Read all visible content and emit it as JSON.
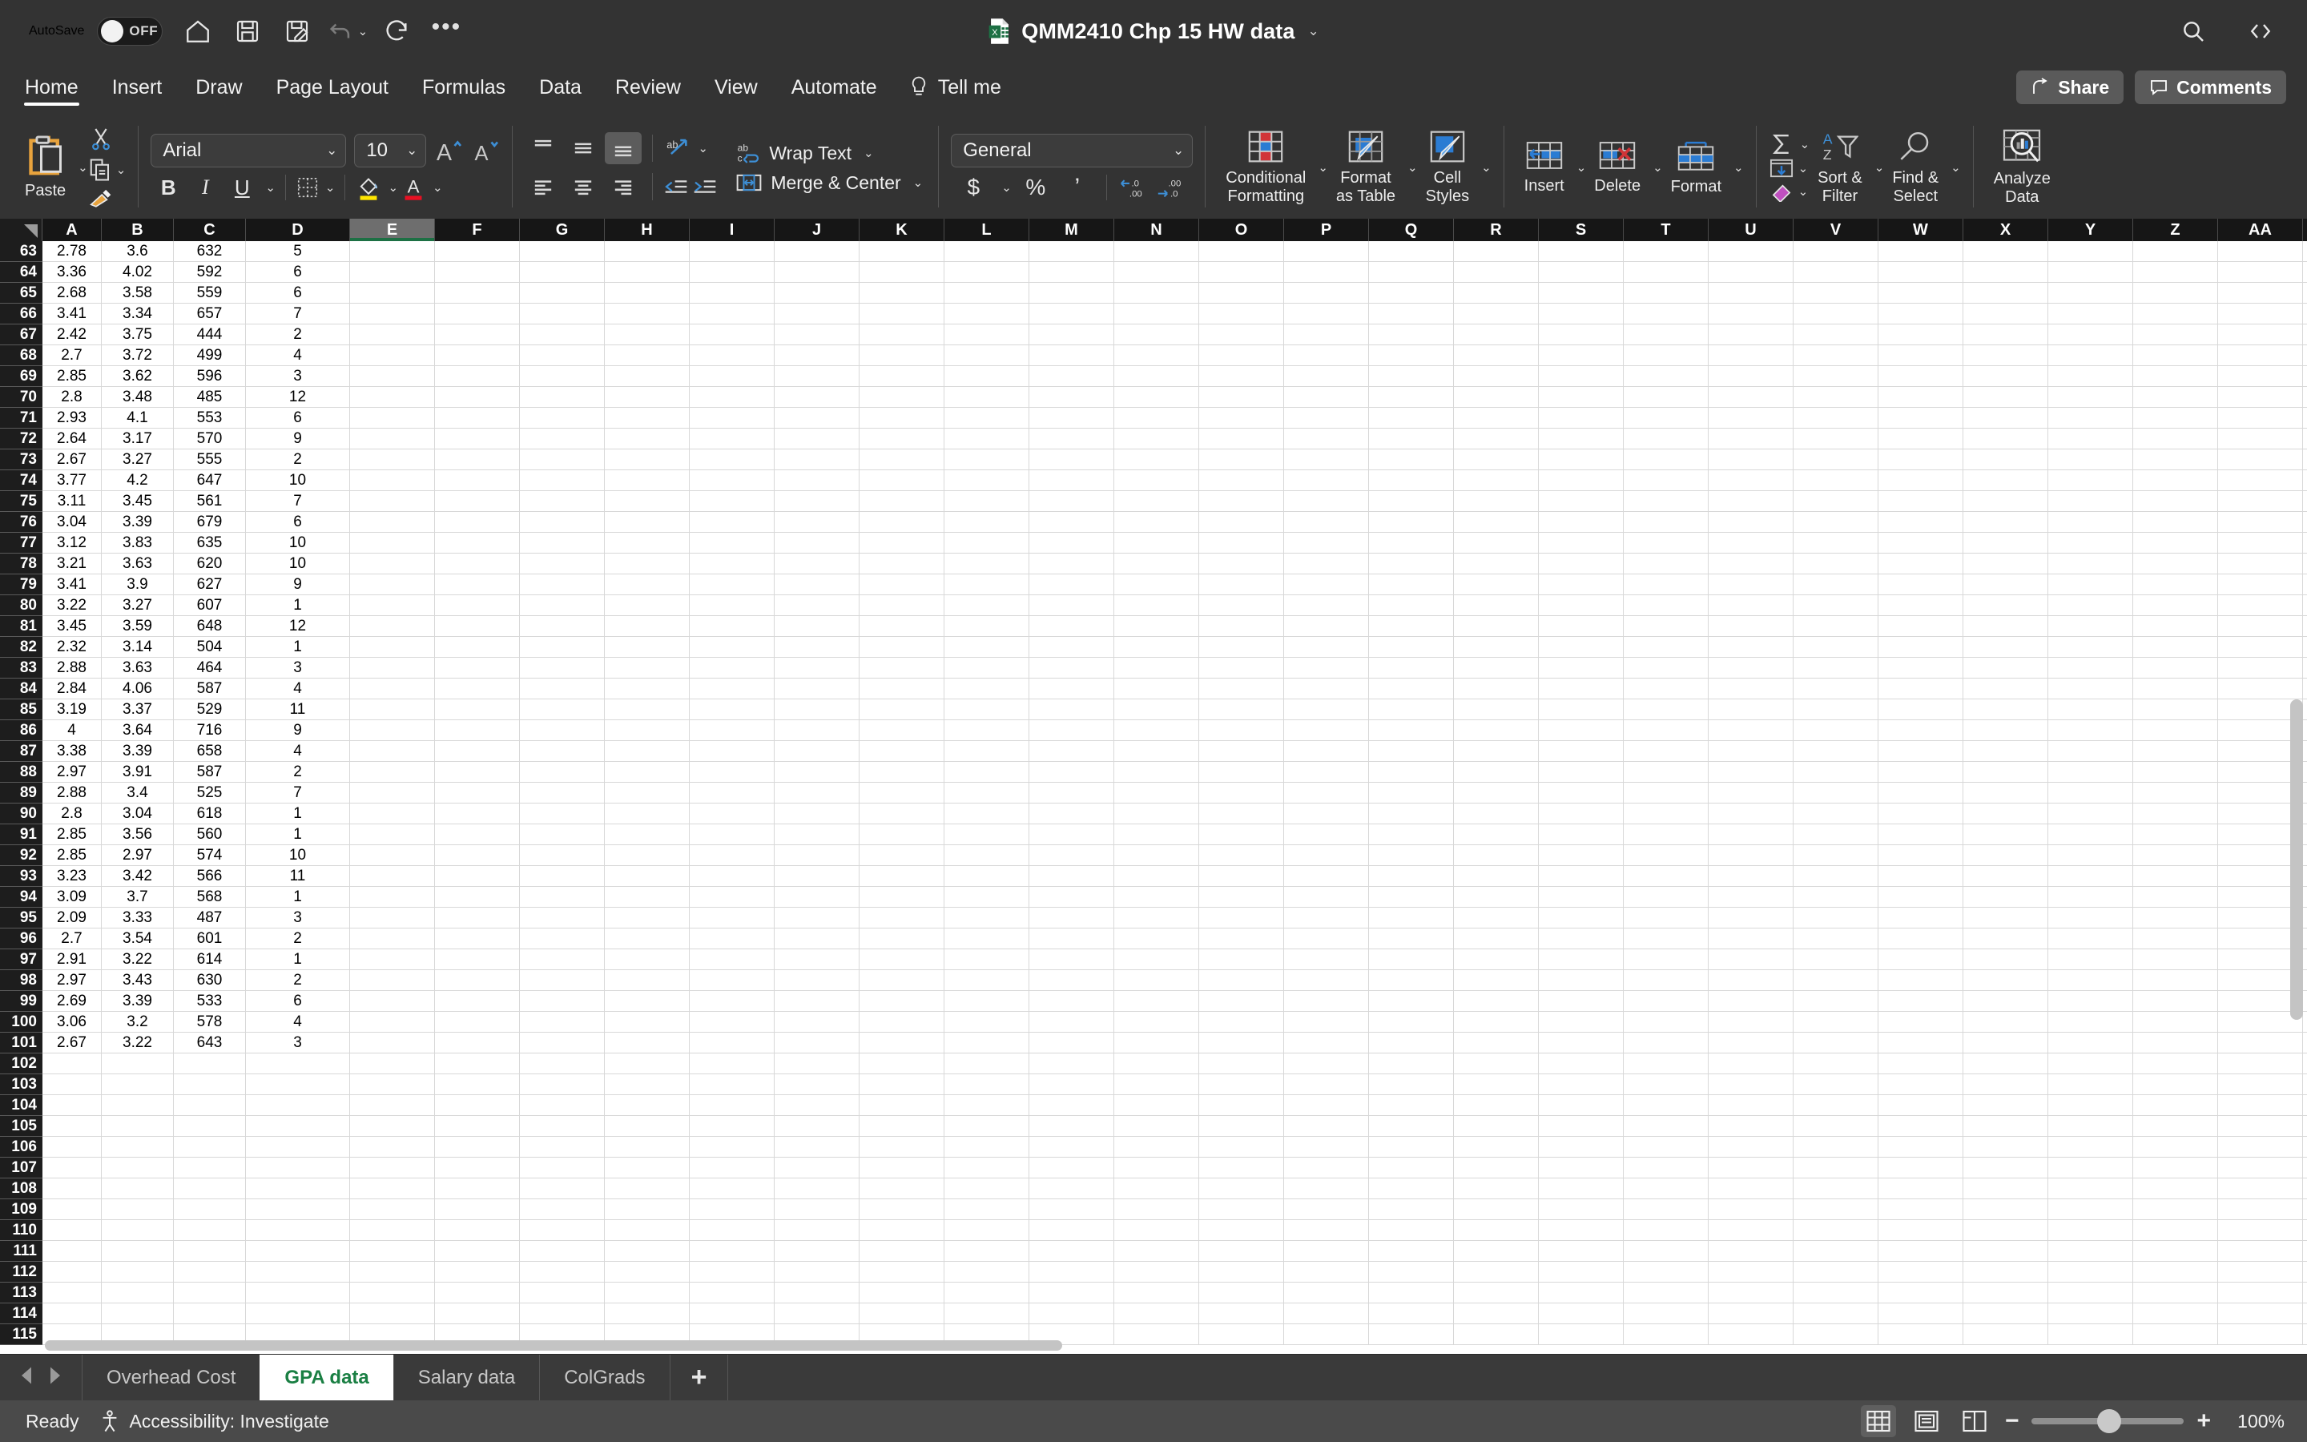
{
  "titlebar": {
    "autosave_label": "AutoSave",
    "autosave_state": "OFF",
    "document_title": "QMM2410 Chp 15 HW data",
    "quick_access": [
      "home-icon",
      "save-icon",
      "save-as-icon",
      "undo-icon",
      "redo-icon",
      "more-options-icon"
    ],
    "search_icon": "search-icon",
    "ribbon_display_icon": "ribbon-display-options-icon"
  },
  "ribbon_tabs": {
    "tabs": [
      {
        "label": "Home",
        "active": true
      },
      {
        "label": "Insert",
        "active": false
      },
      {
        "label": "Draw",
        "active": false
      },
      {
        "label": "Page Layout",
        "active": false
      },
      {
        "label": "Formulas",
        "active": false
      },
      {
        "label": "Data",
        "active": false
      },
      {
        "label": "Review",
        "active": false
      },
      {
        "label": "View",
        "active": false
      },
      {
        "label": "Automate",
        "active": false
      }
    ],
    "tell_me": "Tell me",
    "share": "Share",
    "comments": "Comments"
  },
  "ribbon": {
    "paste_label": "Paste",
    "font_name": "Arial",
    "font_size": "10",
    "bold": "B",
    "italic": "I",
    "underline": "U",
    "wrap_text": "Wrap Text",
    "merge_center": "Merge & Center",
    "number_format": "General",
    "currency": "$",
    "percent": "%",
    "comma": "’",
    "conditional_formatting": "Conditional\nFormatting",
    "conditional_formatting_line1": "Conditional",
    "conditional_formatting_line2": "Formatting",
    "format_as_table_line1": "Format",
    "format_as_table_line2": "as Table",
    "cell_styles_line1": "Cell",
    "cell_styles_line2": "Styles",
    "insert": "Insert",
    "delete": "Delete",
    "format": "Format",
    "sort_filter_line1": "Sort &",
    "sort_filter_line2": "Filter",
    "find_select_line1": "Find &",
    "find_select_line2": "Select",
    "analyze_data_line1": "Analyze",
    "analyze_data_line2": "Data"
  },
  "grid": {
    "columns": [
      "A",
      "B",
      "C",
      "D",
      "E",
      "F",
      "G",
      "H",
      "I",
      "J",
      "K",
      "L",
      "M",
      "N",
      "O",
      "P",
      "Q",
      "R",
      "S",
      "T",
      "U",
      "V",
      "W",
      "X",
      "Y",
      "Z",
      "AA"
    ],
    "selected_column": "E",
    "first_visible_row": 63,
    "last_visible_row": 115,
    "rows": [
      {
        "n": 63,
        "a": "2.78",
        "b": "3.6",
        "c": "632",
        "d": "5"
      },
      {
        "n": 64,
        "a": "3.36",
        "b": "4.02",
        "c": "592",
        "d": "6"
      },
      {
        "n": 65,
        "a": "2.68",
        "b": "3.58",
        "c": "559",
        "d": "6"
      },
      {
        "n": 66,
        "a": "3.41",
        "b": "3.34",
        "c": "657",
        "d": "7"
      },
      {
        "n": 67,
        "a": "2.42",
        "b": "3.75",
        "c": "444",
        "d": "2"
      },
      {
        "n": 68,
        "a": "2.7",
        "b": "3.72",
        "c": "499",
        "d": "4"
      },
      {
        "n": 69,
        "a": "2.85",
        "b": "3.62",
        "c": "596",
        "d": "3"
      },
      {
        "n": 70,
        "a": "2.8",
        "b": "3.48",
        "c": "485",
        "d": "12"
      },
      {
        "n": 71,
        "a": "2.93",
        "b": "4.1",
        "c": "553",
        "d": "6"
      },
      {
        "n": 72,
        "a": "2.64",
        "b": "3.17",
        "c": "570",
        "d": "9"
      },
      {
        "n": 73,
        "a": "2.67",
        "b": "3.27",
        "c": "555",
        "d": "2"
      },
      {
        "n": 74,
        "a": "3.77",
        "b": "4.2",
        "c": "647",
        "d": "10"
      },
      {
        "n": 75,
        "a": "3.11",
        "b": "3.45",
        "c": "561",
        "d": "7"
      },
      {
        "n": 76,
        "a": "3.04",
        "b": "3.39",
        "c": "679",
        "d": "6"
      },
      {
        "n": 77,
        "a": "3.12",
        "b": "3.83",
        "c": "635",
        "d": "10"
      },
      {
        "n": 78,
        "a": "3.21",
        "b": "3.63",
        "c": "620",
        "d": "10"
      },
      {
        "n": 79,
        "a": "3.41",
        "b": "3.9",
        "c": "627",
        "d": "9"
      },
      {
        "n": 80,
        "a": "3.22",
        "b": "3.27",
        "c": "607",
        "d": "1"
      },
      {
        "n": 81,
        "a": "3.45",
        "b": "3.59",
        "c": "648",
        "d": "12"
      },
      {
        "n": 82,
        "a": "2.32",
        "b": "3.14",
        "c": "504",
        "d": "1"
      },
      {
        "n": 83,
        "a": "2.88",
        "b": "3.63",
        "c": "464",
        "d": "3"
      },
      {
        "n": 84,
        "a": "2.84",
        "b": "4.06",
        "c": "587",
        "d": "4"
      },
      {
        "n": 85,
        "a": "3.19",
        "b": "3.37",
        "c": "529",
        "d": "11"
      },
      {
        "n": 86,
        "a": "4",
        "b": "3.64",
        "c": "716",
        "d": "9"
      },
      {
        "n": 87,
        "a": "3.38",
        "b": "3.39",
        "c": "658",
        "d": "4"
      },
      {
        "n": 88,
        "a": "2.97",
        "b": "3.91",
        "c": "587",
        "d": "2"
      },
      {
        "n": 89,
        "a": "2.88",
        "b": "3.4",
        "c": "525",
        "d": "7"
      },
      {
        "n": 90,
        "a": "2.8",
        "b": "3.04",
        "c": "618",
        "d": "1"
      },
      {
        "n": 91,
        "a": "2.85",
        "b": "3.56",
        "c": "560",
        "d": "1"
      },
      {
        "n": 92,
        "a": "2.85",
        "b": "2.97",
        "c": "574",
        "d": "10"
      },
      {
        "n": 93,
        "a": "3.23",
        "b": "3.42",
        "c": "566",
        "d": "11"
      },
      {
        "n": 94,
        "a": "3.09",
        "b": "3.7",
        "c": "568",
        "d": "1"
      },
      {
        "n": 95,
        "a": "2.09",
        "b": "3.33",
        "c": "487",
        "d": "3"
      },
      {
        "n": 96,
        "a": "2.7",
        "b": "3.54",
        "c": "601",
        "d": "2"
      },
      {
        "n": 97,
        "a": "2.91",
        "b": "3.22",
        "c": "614",
        "d": "1"
      },
      {
        "n": 98,
        "a": "2.97",
        "b": "3.43",
        "c": "630",
        "d": "2"
      },
      {
        "n": 99,
        "a": "2.69",
        "b": "3.39",
        "c": "533",
        "d": "6"
      },
      {
        "n": 100,
        "a": "3.06",
        "b": "3.2",
        "c": "578",
        "d": "4"
      },
      {
        "n": 101,
        "a": "2.67",
        "b": "3.22",
        "c": "643",
        "d": "3"
      },
      {
        "n": 102,
        "a": "",
        "b": "",
        "c": "",
        "d": ""
      },
      {
        "n": 103,
        "a": "",
        "b": "",
        "c": "",
        "d": ""
      },
      {
        "n": 104,
        "a": "",
        "b": "",
        "c": "",
        "d": ""
      },
      {
        "n": 105,
        "a": "",
        "b": "",
        "c": "",
        "d": ""
      },
      {
        "n": 106,
        "a": "",
        "b": "",
        "c": "",
        "d": ""
      },
      {
        "n": 107,
        "a": "",
        "b": "",
        "c": "",
        "d": ""
      },
      {
        "n": 108,
        "a": "",
        "b": "",
        "c": "",
        "d": ""
      },
      {
        "n": 109,
        "a": "",
        "b": "",
        "c": "",
        "d": ""
      },
      {
        "n": 110,
        "a": "",
        "b": "",
        "c": "",
        "d": ""
      },
      {
        "n": 111,
        "a": "",
        "b": "",
        "c": "",
        "d": ""
      },
      {
        "n": 112,
        "a": "",
        "b": "",
        "c": "",
        "d": ""
      },
      {
        "n": 113,
        "a": "",
        "b": "",
        "c": "",
        "d": ""
      },
      {
        "n": 114,
        "a": "",
        "b": "",
        "c": "",
        "d": ""
      },
      {
        "n": 115,
        "a": "",
        "b": "",
        "c": "",
        "d": ""
      }
    ]
  },
  "sheet_tabs": {
    "tabs": [
      {
        "label": "Overhead Cost",
        "active": false
      },
      {
        "label": "GPA data",
        "active": true
      },
      {
        "label": "Salary data",
        "active": false
      },
      {
        "label": "ColGrads",
        "active": false
      }
    ],
    "add_sheet": "+"
  },
  "statusbar": {
    "mode": "Ready",
    "accessibility": "Accessibility: Investigate",
    "views": [
      "normal-view-icon",
      "page-layout-view-icon",
      "page-break-preview-icon"
    ],
    "zoom_out": "−",
    "zoom_in": "+",
    "zoom_value": "100%"
  },
  "colors": {
    "chrome": "#333333",
    "accent_green": "#1a7f43",
    "paste_orange": "#e8a33d",
    "highlight_yellow": "#ffe600",
    "font_red": "#e81123",
    "accent_blue": "#2b7cd3"
  }
}
